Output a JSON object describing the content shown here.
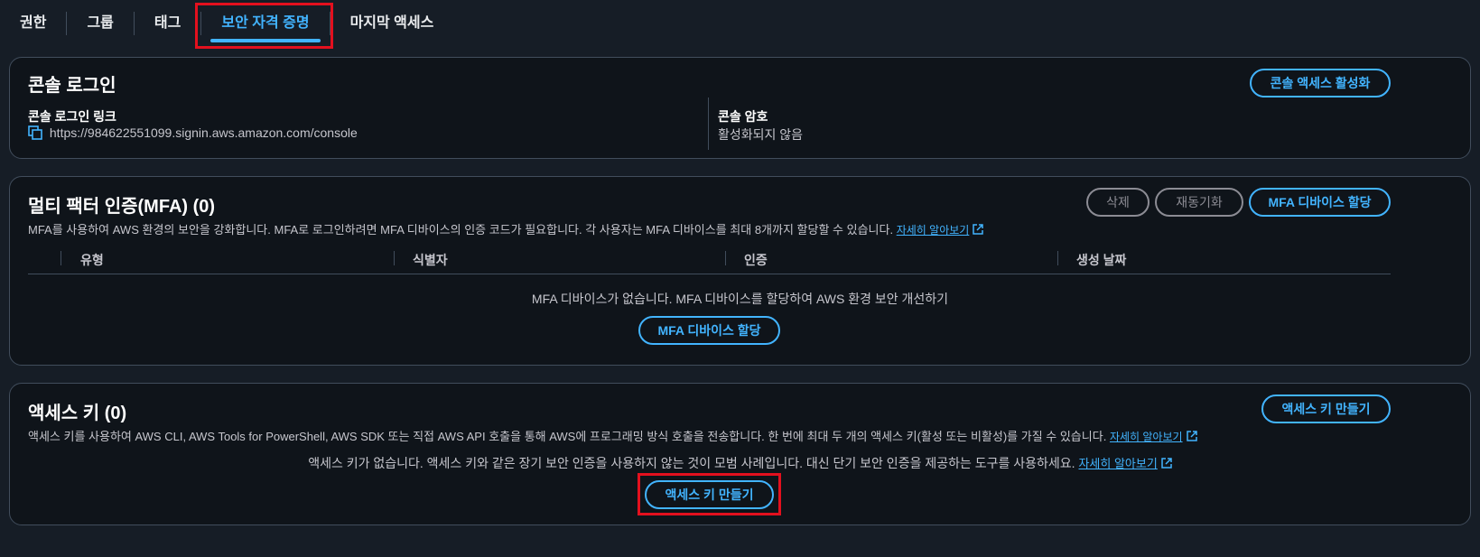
{
  "tabs": [
    "권한",
    "그룹",
    "태그",
    "보안 자격 증명",
    "마지막 액세스"
  ],
  "active_tab_index": 3,
  "console": {
    "title": "콘솔 로그인",
    "enable_button": "콘솔 액세스 활성화",
    "link_label": "콘솔 로그인 링크",
    "link_value": "https://984622551099.signin.aws.amazon.com/console",
    "password_label": "콘솔 암호",
    "password_value": "활성화되지 않음"
  },
  "mfa": {
    "title": "멀티 팩터 인증(MFA) (0)",
    "delete_button": "삭제",
    "resync_button": "재동기화",
    "assign_button": "MFA 디바이스 할당",
    "description": "MFA를 사용하여 AWS 환경의 보안을 강화합니다. MFA로 로그인하려면 MFA 디바이스의 인증 코드가 필요합니다. 각 사용자는 MFA 디바이스를 최대 8개까지 할당할 수 있습니다.",
    "learn_more": "자세히 알아보기",
    "columns": [
      "유형",
      "식별자",
      "인증",
      "생성 날짜"
    ],
    "empty_message": "MFA 디바이스가 없습니다. MFA 디바이스를 할당하여 AWS 환경 보안 개선하기",
    "empty_button": "MFA 디바이스 할당"
  },
  "access_keys": {
    "title": "액세스 키 (0)",
    "create_button": "액세스 키 만들기",
    "description": "액세스 키를 사용하여 AWS CLI, AWS Tools for PowerShell, AWS SDK 또는 직접 AWS API 호출을 통해 AWS에 프로그래밍 방식 호출을 전송합니다. 한 번에 최대 두 개의 액세스 키(활성 또는 비활성)를 가질 수 있습니다.",
    "learn_more": "자세히 알아보기",
    "empty_message": "액세스 키가 없습니다. 액세스 키와 같은 장기 보안 인증을 사용하지 않는 것이 모범 사례입니다. 대신 단기 보안 인증을 제공하는 도구를 사용하세요.",
    "empty_learn_more": "자세히 알아보기",
    "empty_button": "액세스 키 만들기"
  },
  "colors": {
    "accent": "#42b4ff",
    "highlight": "#e3101e",
    "background": "#161d26",
    "card": "#0f141a"
  }
}
